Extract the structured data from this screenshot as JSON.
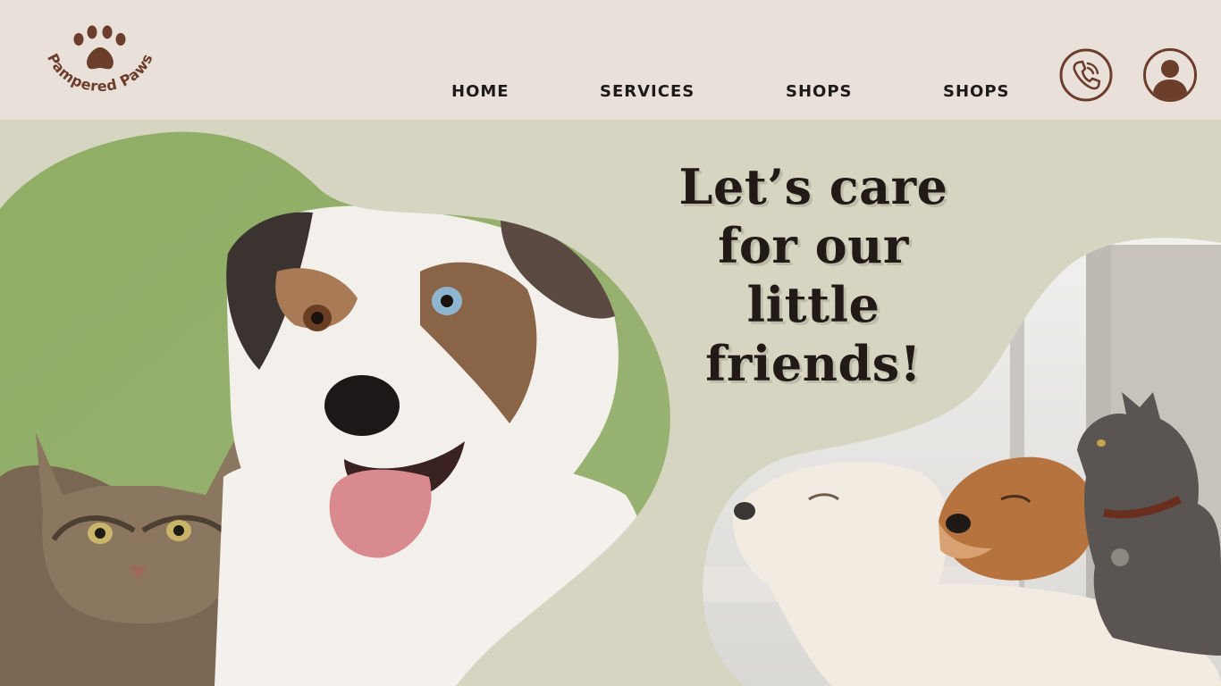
{
  "brand": {
    "name": "Pampered Paws",
    "color": "#6b3d2b"
  },
  "nav": {
    "items": [
      {
        "label": "HOME"
      },
      {
        "label": "SERVICES"
      },
      {
        "label": "SHOPS"
      },
      {
        "label": "SHOPS"
      }
    ]
  },
  "actions": {
    "phone_icon": "phone-icon",
    "account_icon": "user-icon"
  },
  "hero": {
    "headline_lines": [
      "Let’s care",
      "for our little",
      "friends!"
    ],
    "left_image": "cat-and-dog-photo",
    "right_image": "dogs-and-cat-cuddling-photo"
  },
  "colors": {
    "header_bg": "#eae0da",
    "page_bg": "#d6d5c1",
    "accent_brown": "#6b3d2b",
    "text_dark": "#211a16"
  }
}
